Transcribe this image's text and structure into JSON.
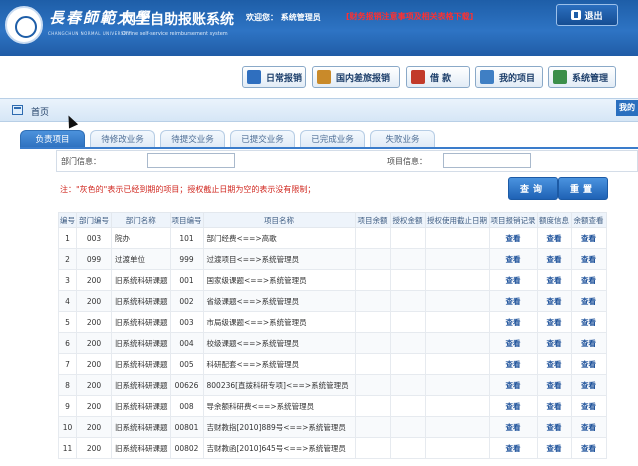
{
  "header": {
    "university_name": "長春師範大學",
    "university_name_en": "CHANGCHUN NORMAL UNIVERSITY",
    "system_title": "网上自助报账系统",
    "system_subtitle": "Online self-service reimbursement system",
    "welcome": "欢迎您： 系统管理员",
    "notice": "[财务报销注意事项及相关表格下载]",
    "logout_label": "退出"
  },
  "toolbar": {
    "buttons": [
      {
        "label": "日常报销",
        "color": "#2f6fbf"
      },
      {
        "label": "国内差旅报销",
        "color": "#c98a2a"
      },
      {
        "label": "借  款",
        "color": "#c23a2a"
      },
      {
        "label": "我的项目",
        "color": "#3f7fc4"
      },
      {
        "label": "系统管理",
        "color": "#3c8f4a"
      }
    ]
  },
  "location": {
    "home_label": "首页",
    "right_edge_label": "我的"
  },
  "tabs": [
    "负责项目",
    "待修改业务",
    "待提交业务",
    "已提交业务",
    "已完成业务",
    "失败业务"
  ],
  "filter": {
    "dept_label": "部门信息：",
    "project_label": "项目信息：",
    "dept_value": "",
    "project_value": ""
  },
  "hint": "注：\"灰色的\"表示已经到期的项目；授权截止日期为空的表示没有限制；",
  "actions": {
    "query_label": "查询",
    "reset_label": "重置"
  },
  "table": {
    "columns": [
      "编号",
      "部门编号",
      "部门名称",
      "项目编号",
      "项目名称",
      "项目余额",
      "授权金额",
      "授权使用截止日期",
      "项目报销记录",
      "额度信息",
      "余额查看"
    ],
    "view_label": "查看",
    "rows": [
      {
        "no": "1",
        "dept_code": "003",
        "dept_name": "院办",
        "proj_code": "101",
        "proj_name": "部门经费<==>高歌"
      },
      {
        "no": "2",
        "dept_code": "099",
        "dept_name": "过渡单位",
        "proj_code": "999",
        "proj_name": "过渡项目<==>系统管理员"
      },
      {
        "no": "3",
        "dept_code": "200",
        "dept_name": "旧系统科研课题",
        "proj_code": "001",
        "proj_name": "国家级课题<==>系统管理员"
      },
      {
        "no": "4",
        "dept_code": "200",
        "dept_name": "旧系统科研课题",
        "proj_code": "002",
        "proj_name": "省级课题<==>系统管理员"
      },
      {
        "no": "5",
        "dept_code": "200",
        "dept_name": "旧系统科研课题",
        "proj_code": "003",
        "proj_name": "市局级课题<==>系统管理员"
      },
      {
        "no": "6",
        "dept_code": "200",
        "dept_name": "旧系统科研课题",
        "proj_code": "004",
        "proj_name": "校级课题<==>系统管理员"
      },
      {
        "no": "7",
        "dept_code": "200",
        "dept_name": "旧系统科研课题",
        "proj_code": "005",
        "proj_name": "科研配套<==>系统管理员"
      },
      {
        "no": "8",
        "dept_code": "200",
        "dept_name": "旧系统科研课题",
        "proj_code": "00626",
        "proj_name": "800236[直拨科研专项]<==>系统管理员"
      },
      {
        "no": "9",
        "dept_code": "200",
        "dept_name": "旧系统科研课题",
        "proj_code": "008",
        "proj_name": "导余额科研费<==>系统管理员"
      },
      {
        "no": "10",
        "dept_code": "200",
        "dept_name": "旧系统科研课题",
        "proj_code": "00801",
        "proj_name": "吉财教指[2010]889号<==>系统管理员"
      },
      {
        "no": "11",
        "dept_code": "200",
        "dept_name": "旧系统科研课题",
        "proj_code": "00802",
        "proj_name": "吉财教函[2010]645号<==>系统管理员"
      }
    ]
  }
}
